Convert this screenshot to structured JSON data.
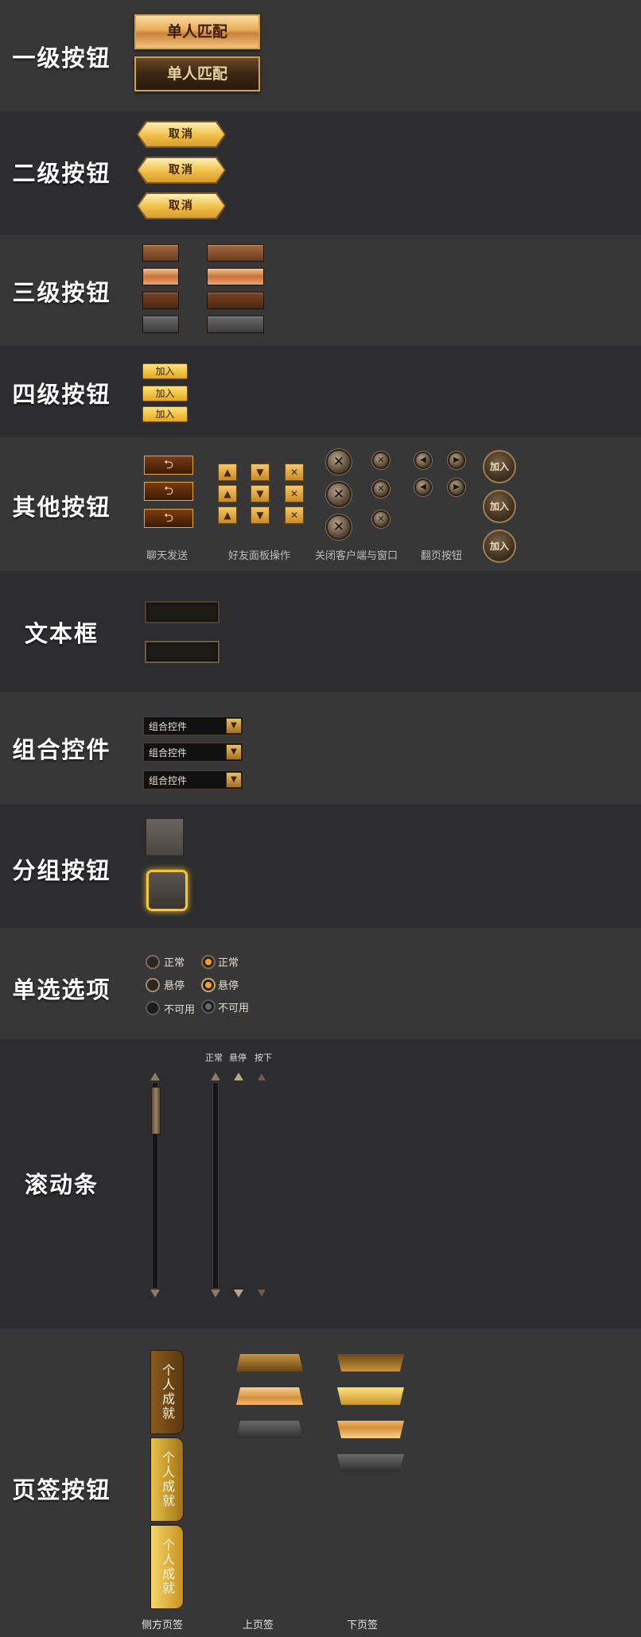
{
  "sections": {
    "level1": {
      "title": "一级按钮",
      "buttons": [
        "单人匹配",
        "单人匹配"
      ]
    },
    "level2": {
      "title": "二级按钮",
      "buttons": [
        "取消",
        "取消",
        "取消"
      ]
    },
    "level3": {
      "title": "三级按钮"
    },
    "level4": {
      "title": "四级按钮",
      "buttons": [
        "加入",
        "加入",
        "加入"
      ]
    },
    "other": {
      "title": "其他按钮",
      "captions": [
        "聊天发送",
        "好友面板操作",
        "关闭客户端与窗口",
        "翻页按钮"
      ],
      "join_buttons": [
        "加入",
        "加入",
        "加入"
      ]
    },
    "textbox": {
      "title": "文本框"
    },
    "combo": {
      "title": "组合控件",
      "items": [
        "组合控件",
        "组合控件",
        "组合控件"
      ]
    },
    "group": {
      "title": "分组按钮"
    },
    "radio": {
      "title": "单选选项",
      "left": [
        "正常",
        "悬停",
        "不可用"
      ],
      "right": [
        "正常",
        "悬停",
        "不可用"
      ]
    },
    "scroll": {
      "title": "滚动条",
      "states": [
        "正常",
        "悬停",
        "按下"
      ]
    },
    "tabs": {
      "title": "页签按钮",
      "side_label": "个人成就",
      "captions": [
        "侧方页签",
        "上页签",
        "下页签"
      ]
    }
  },
  "colors": {
    "gold": "#e9a957",
    "accent_orange": "#ff9a2e",
    "bg_dark": "#2d2d2f",
    "bg_mid": "#373738"
  }
}
